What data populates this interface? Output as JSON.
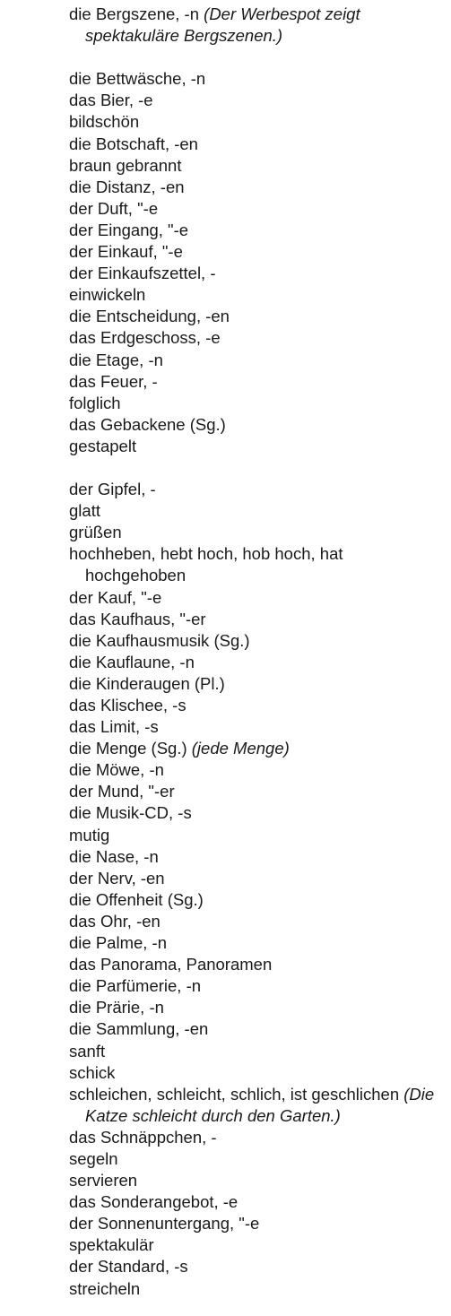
{
  "entries": [
    {
      "term": "die Bergszene, -n",
      "note": "(Der Werbespot zeigt spektakuläre Bergszenen.)",
      "gap_after": true
    },
    {
      "term": "die Bettwäsche, -n"
    },
    {
      "term": "das Bier, -e"
    },
    {
      "term": "bildschön"
    },
    {
      "term": "die Botschaft, -en"
    },
    {
      "term": "braun gebrannt"
    },
    {
      "term": "die Distanz, -en"
    },
    {
      "term": "der Duft, \"-e"
    },
    {
      "term": "der Eingang, \"-e"
    },
    {
      "term": "der Einkauf, \"-e"
    },
    {
      "term": "der Einkaufszettel, -"
    },
    {
      "term": "einwickeln"
    },
    {
      "term": "die Entscheidung, -en"
    },
    {
      "term": "das Erdgeschoss, -e"
    },
    {
      "term": "die Etage, -n"
    },
    {
      "term": "das Feuer, -"
    },
    {
      "term": "folglich"
    },
    {
      "term": "das Gebackene (Sg.)"
    },
    {
      "term": "gestapelt",
      "gap_after": true
    },
    {
      "term": "der Gipfel, -"
    },
    {
      "term": "glatt"
    },
    {
      "term": "grüßen"
    },
    {
      "term": "hochheben, hebt hoch, hob hoch, hat hochgehoben"
    },
    {
      "term": "der Kauf, \"-e"
    },
    {
      "term": "das Kaufhaus, \"-er"
    },
    {
      "term": "die Kaufhausmusik (Sg.)"
    },
    {
      "term": "die Kauflaune, -n"
    },
    {
      "term": "die Kinderaugen (Pl.)"
    },
    {
      "term": "das Klischee, -s"
    },
    {
      "term": "das Limit, -s"
    },
    {
      "term": "die Menge (Sg.)",
      "note": "(jede Menge)"
    },
    {
      "term": "die Möwe, -n"
    },
    {
      "term": "der Mund, \"-er"
    },
    {
      "term": "die Musik-CD, -s"
    },
    {
      "term": "mutig"
    },
    {
      "term": "die Nase, -n"
    },
    {
      "term": "der Nerv, -en"
    },
    {
      "term": "die Offenheit (Sg.)"
    },
    {
      "term": "das Ohr, -en"
    },
    {
      "term": "die Palme, -n"
    },
    {
      "term": "das Panorama, Panoramen"
    },
    {
      "term": "die Parfümerie, -n"
    },
    {
      "term": "die Prärie, -n"
    },
    {
      "term": "die Sammlung, -en"
    },
    {
      "term": "sanft"
    },
    {
      "term": "schick"
    },
    {
      "term": "schleichen, schleicht, schlich, ist geschlichen",
      "note": "(Die Katze schleicht durch den Garten.)"
    },
    {
      "term": "das Schnäppchen, -"
    },
    {
      "term": "segeln"
    },
    {
      "term": "servieren"
    },
    {
      "term": "das Sonderangebot, -e"
    },
    {
      "term": "der Sonnenuntergang, \"-e"
    },
    {
      "term": "spektakulär"
    },
    {
      "term": "der Standard, -s"
    },
    {
      "term": "streicheln"
    }
  ]
}
